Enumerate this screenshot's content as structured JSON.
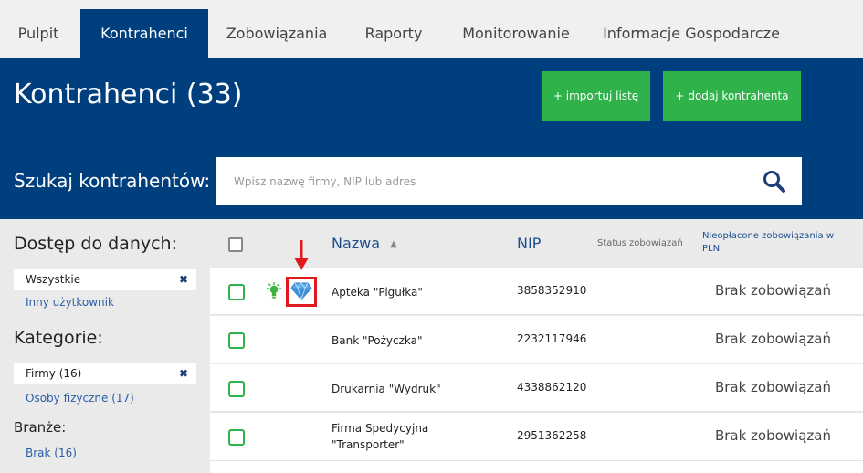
{
  "nav": {
    "tabs": [
      {
        "label": "Pulpit"
      },
      {
        "label": "Kontrahenci"
      },
      {
        "label": "Zobowiązania"
      },
      {
        "label": "Raporty"
      },
      {
        "label": "Monitorowanie"
      },
      {
        "label": "Informacje Gospodarcze"
      }
    ]
  },
  "header": {
    "title": "Kontrahenci (33)",
    "import_label": "+ importuj listę",
    "add_label": "+ dodaj kontrahenta"
  },
  "search": {
    "label": "Szukaj kontrahentów:",
    "placeholder": "Wpisz nazwę firmy, NIP lub adres",
    "icon": "search-icon"
  },
  "sidebar": {
    "access_heading": "Dostęp do danych:",
    "access_selected": "Wszystkie",
    "access_other": "Inny użytkownik",
    "category_heading": "Kategorie:",
    "category_selected": "Firmy (16)",
    "category_other": "Osoby fizyczne (17)",
    "branch_heading": "Branże:",
    "branch_item": "Brak (16)"
  },
  "table": {
    "headers": {
      "name": "Nazwa",
      "nip": "NIP",
      "status": "Status zobowiązań",
      "unpaid": "Nieopłacone zobowiązania w PLN"
    },
    "rows": [
      {
        "name": "Apteka \"Pigułka\"",
        "nip": "3858352910",
        "status": "Brak zobowiązań"
      },
      {
        "name": "Bank \"Pożyczka\"",
        "nip": "2232117946",
        "status": "Brak zobowiązań"
      },
      {
        "name": "Drukarnia \"Wydruk\"",
        "nip": "4338862120",
        "status": "Brak zobowiązań"
      },
      {
        "name_line1": "Firma Spedycyjna",
        "name_line2": "\"Transporter\"",
        "nip": "2951362258",
        "status": "Brak zobowiązań"
      }
    ]
  },
  "colors": {
    "brand_blue": "#003f7d",
    "green": "#2fb24a",
    "highlight_red": "#e0191f"
  }
}
